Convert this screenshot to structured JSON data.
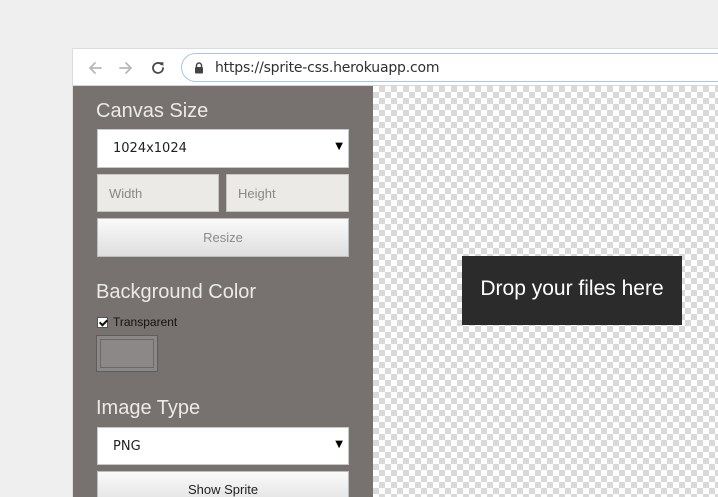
{
  "browser": {
    "url": "https://sprite-css.herokuapp.com",
    "icons": {
      "back": "back-arrow-icon",
      "forward": "forward-arrow-icon",
      "reload": "reload-icon",
      "lock": "lock-icon"
    }
  },
  "sidebar": {
    "canvas_size": {
      "title": "Canvas Size",
      "selected": "1024x1024",
      "width_placeholder": "Width",
      "height_placeholder": "Height",
      "resize_label": "Resize"
    },
    "background_color": {
      "title": "Background Color",
      "transparent_label": "Transparent",
      "transparent_checked": true,
      "swatch_color": "#8b8887"
    },
    "image_type": {
      "title": "Image Type",
      "selected": "PNG",
      "show_sprite_label": "Show Sprite"
    }
  },
  "canvas": {
    "dropzone_text": "Drop your files here"
  },
  "colors": {
    "sidebar_bg": "#777270",
    "dropzone_bg": "#2b2b2b",
    "url_focus": "#a9c7ee"
  }
}
